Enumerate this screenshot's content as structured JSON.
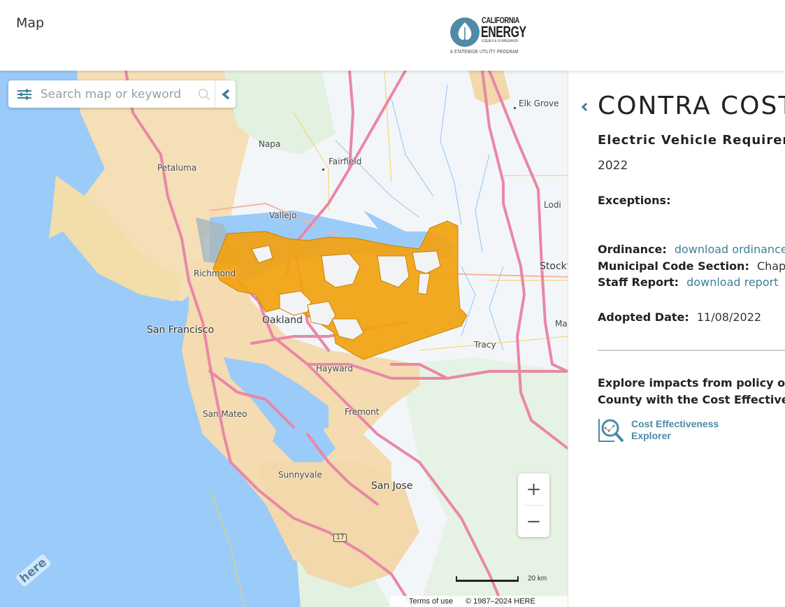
{
  "header": {
    "title": "Map",
    "logo": {
      "line1": "CALIFORNIA",
      "line2": "ENERGY",
      "line3": "CODES & STANDARDS",
      "line4": "A STATEWIDE UTILITY PROGRAM"
    }
  },
  "map": {
    "search": {
      "placeholder": "Search map or keyword",
      "value": ""
    },
    "icons": {
      "filter": "sliders-icon",
      "search": "search-icon",
      "collapse": "chevron-left-icon"
    },
    "highlighted_region": "Contra Costa County",
    "highlight_color": "#f2a20f",
    "labels": {
      "elk_grove": "Elk Grove",
      "napa": "Napa",
      "fairfield": "Fairfield",
      "petaluma": "Petaluma",
      "vallejo": "Vallejo",
      "lodi": "Lodi",
      "richmond": "Richmond",
      "stockton": "Stockt",
      "oakland": "Oakland",
      "san_francisco": "San Francisco",
      "manteca": "Ma",
      "tracy": "Tracy",
      "hayward": "Hayward",
      "fremont": "Fremont",
      "san_mateo": "San Mateo",
      "sunnyvale": "Sunnyvale",
      "san_jose": "San Jose",
      "route_17": "17"
    },
    "zoom_in": "+",
    "zoom_out": "−",
    "scale": "20 km",
    "terms": "Terms of use",
    "copyright": "© 1987–2024 HERE",
    "provider_logo": "here"
  },
  "panel": {
    "title": "CONTRA COSTA",
    "subtitle": "Electric Vehicle Requirem",
    "year": "2022",
    "exceptions_label": "Exceptions:",
    "exceptions_value": "",
    "ordinance_label": "Ordinance:",
    "ordinance_link": "download ordinance",
    "municipal_label": "Municipal Code Section:",
    "municipal_value": "Chapter",
    "staff_label": "Staff Report:",
    "staff_link": "download report",
    "adopted_label": "Adopted Date:",
    "adopted_value": "11/08/2022",
    "explore_line1": "Explore impacts from policy opti",
    "explore_line2": "County with the Cost Effectivene",
    "cee_line1": "Cost Effectiveness",
    "cee_line2": "Explorer",
    "accent_color": "#3f7f96"
  }
}
